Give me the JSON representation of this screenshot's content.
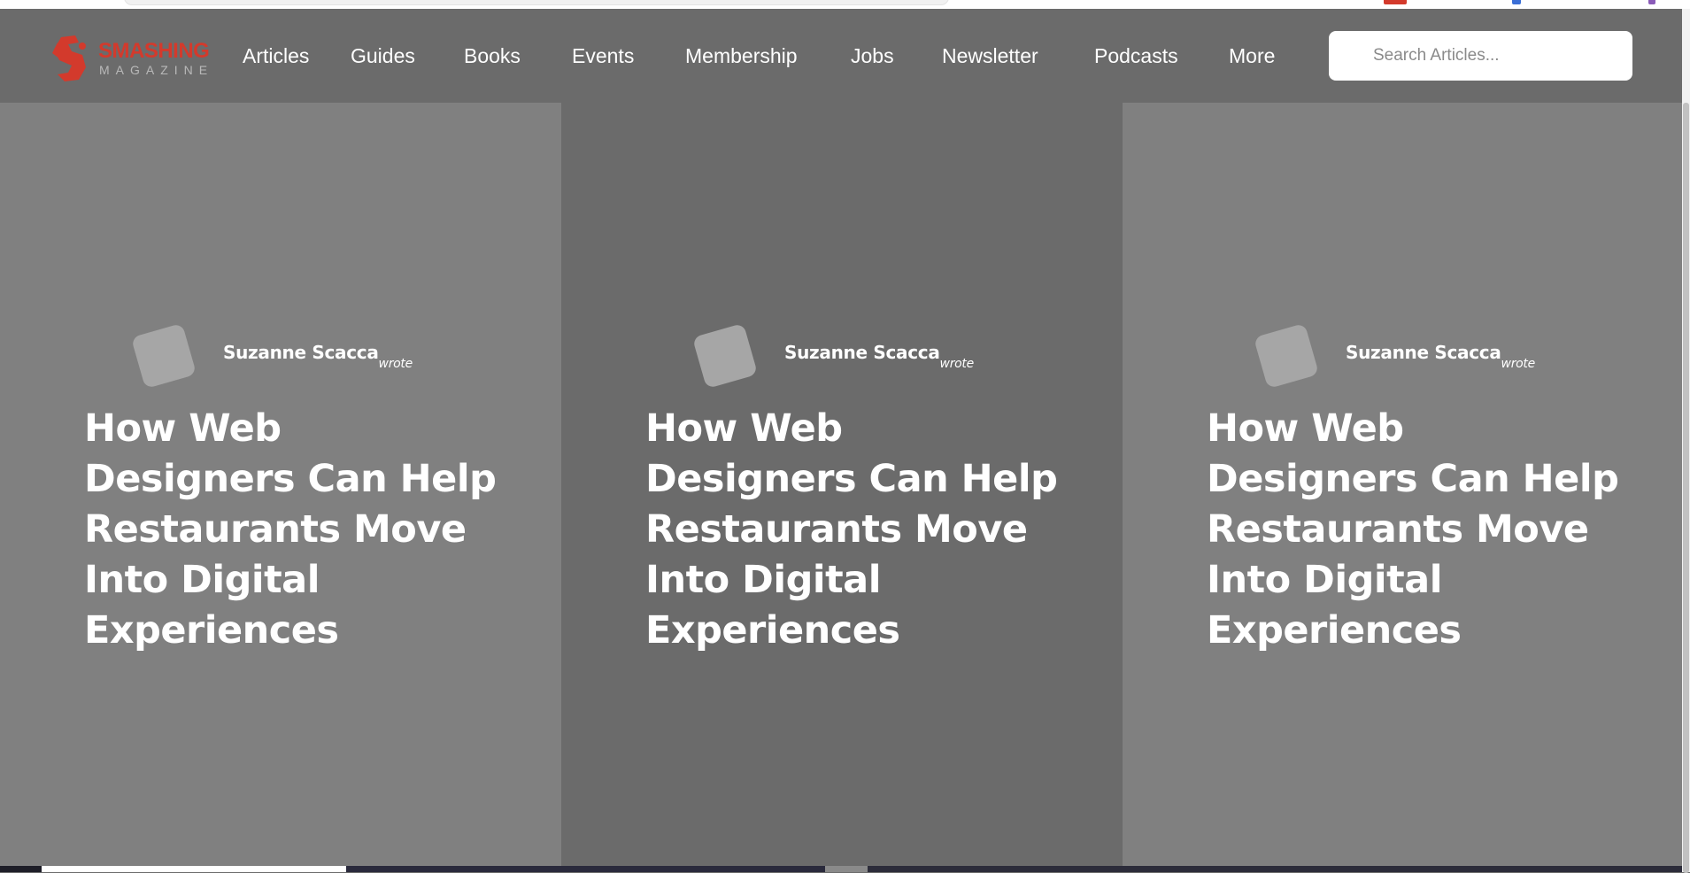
{
  "site": {
    "logo_text": "SMASHING",
    "logo_sub": "MAGAZINE",
    "brand_color": "#d33a2c"
  },
  "nav": {
    "items": [
      {
        "label": "Articles"
      },
      {
        "label": "Guides"
      },
      {
        "label": "Books"
      },
      {
        "label": "Events"
      },
      {
        "label": "Membership"
      },
      {
        "label": "Jobs"
      },
      {
        "label": "Newsletter"
      },
      {
        "label": "Podcasts"
      },
      {
        "label": "More"
      }
    ]
  },
  "search": {
    "placeholder": "Search Articles..."
  },
  "cards": [
    {
      "author": "Suzanne Scacca",
      "verb": "wrote",
      "title": "How Web Designers Can Help Restaurants Move Into Digital Experiences",
      "bg": "#808080"
    },
    {
      "author": "Suzanne Scacca",
      "verb": "wrote",
      "title": "How Web Designers Can Help Restaurants Move Into Digital Experiences",
      "bg": "#6b6b6b"
    },
    {
      "author": "Suzanne Scacca",
      "verb": "wrote",
      "title": "How Web Designers Can Help Restaurants Move Into Digital Experiences",
      "bg": "#808080"
    }
  ],
  "colors": {
    "overlay": "#6b6b6b",
    "card_light": "#808080",
    "avatar": "#a6a6a6",
    "text": "#ffffff"
  }
}
